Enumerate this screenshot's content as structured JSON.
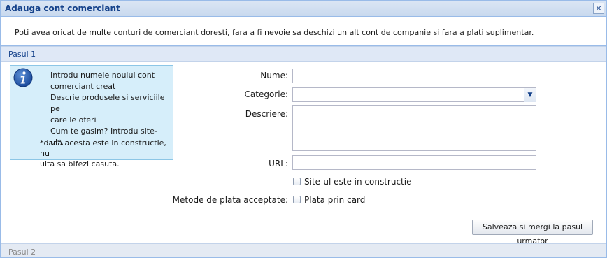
{
  "dialog": {
    "title": "Adauga cont comerciant",
    "close_symbol": "×"
  },
  "intro": {
    "text": "Poti avea oricat de multe conturi de comerciant doresti, fara a fi nevoie sa deschizi un alt cont de companie si fara a plati suplimentar."
  },
  "steps": [
    {
      "label": "Pasul 1"
    },
    {
      "label": "Pasul 2"
    }
  ],
  "info": {
    "icon": "info-icon",
    "lines": [
      "Introdu numele noului cont",
      "comerciant creat",
      "Descrie produsele si serviciile pe",
      "care le oferi",
      "Cum te gasim? Introdu site-ul*."
    ],
    "note_lines": [
      "*daca acesta este in constructie, nu",
      "uita sa bifezi casuta."
    ]
  },
  "form": {
    "name_label": "Nume:",
    "name_value": "",
    "category_label": "Categorie:",
    "category_value": "",
    "description_label": "Descriere:",
    "description_value": "",
    "url_label": "URL:",
    "url_value": "",
    "under_construction_label": "Site-ul este in constructie",
    "under_construction_checked": false,
    "payment_label": "Metode de plata acceptate:",
    "card_payment_label": "Plata prin card",
    "card_payment_checked": false
  },
  "actions": {
    "save_label": "Salveaza si mergi la pasul urmator"
  },
  "colors": {
    "title_text": "#15428b",
    "border": "#99bbe8",
    "info_bg": "#d6eefa",
    "step_bg": "#dfe8f6"
  }
}
